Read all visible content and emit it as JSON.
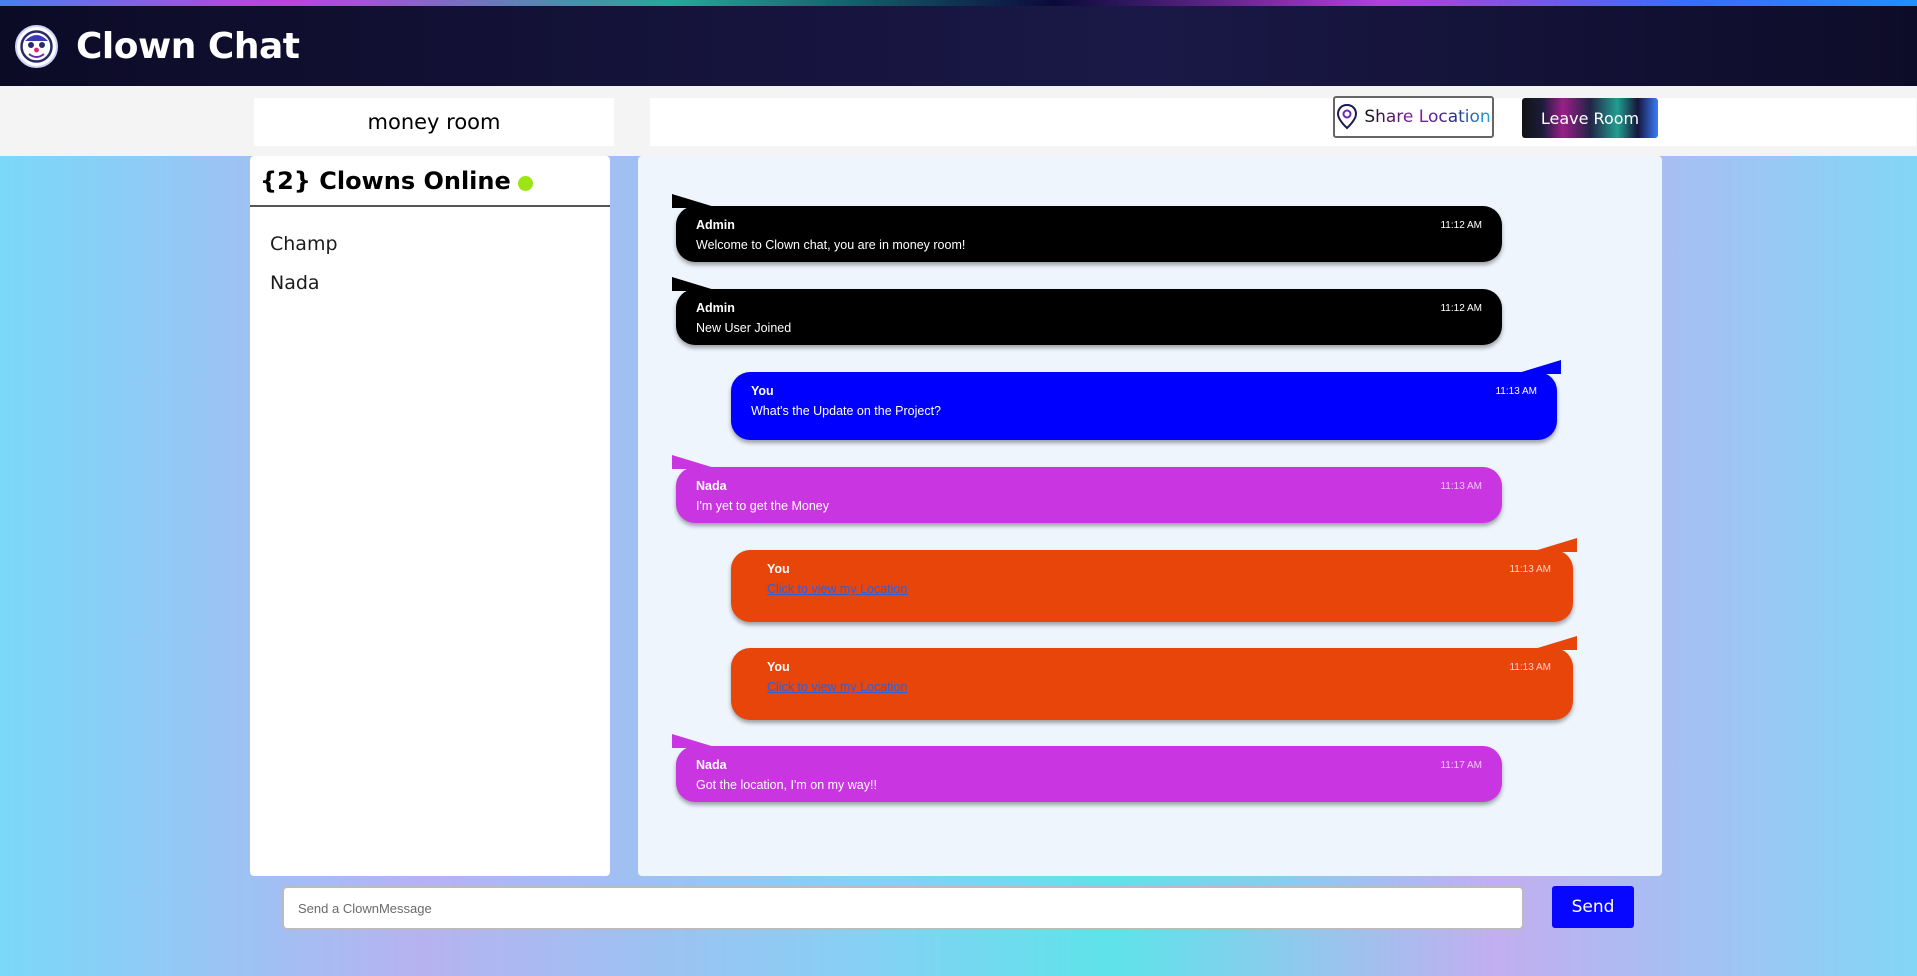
{
  "app": {
    "title": "Clown Chat",
    "logo_icon": "clown-face-icon"
  },
  "room": {
    "name": "money room"
  },
  "actions": {
    "share_location": "Share Location",
    "leave_room": "Leave Room"
  },
  "sidebar": {
    "online_count_label": "{2} Clowns Online",
    "online_dot_color": "#9de414",
    "users": [
      "Champ",
      "Nada"
    ]
  },
  "messages": [
    {
      "sender": "Admin",
      "time": "11:12 AM",
      "text": "Welcome to Clown chat, you are in money room!",
      "color": "#000000"
    },
    {
      "sender": "Admin",
      "time": "11:12 AM",
      "text": "New User Joined",
      "color": "#000000"
    },
    {
      "sender": "You",
      "time": "11:13 AM",
      "text": "What's the Update on the Project?",
      "color": "#0000ff"
    },
    {
      "sender": "Nada",
      "time": "11:13 AM",
      "text": "I'm yet to get the Money",
      "color": "#c935e0"
    },
    {
      "sender": "You",
      "time": "11:13 AM",
      "text": "Click to view my Location",
      "color": "#e8450a"
    },
    {
      "sender": "You",
      "time": "11:13 AM",
      "text": "Click to view my Location",
      "color": "#e8450a"
    },
    {
      "sender": "Nada",
      "time": "11:17 AM",
      "text": "Got the location, I'm on my way!!",
      "color": "#c935e0"
    }
  ],
  "composer": {
    "placeholder": "Send a ClownMessage",
    "value": "",
    "send_label": "Send",
    "send_color": "#0707ff"
  }
}
